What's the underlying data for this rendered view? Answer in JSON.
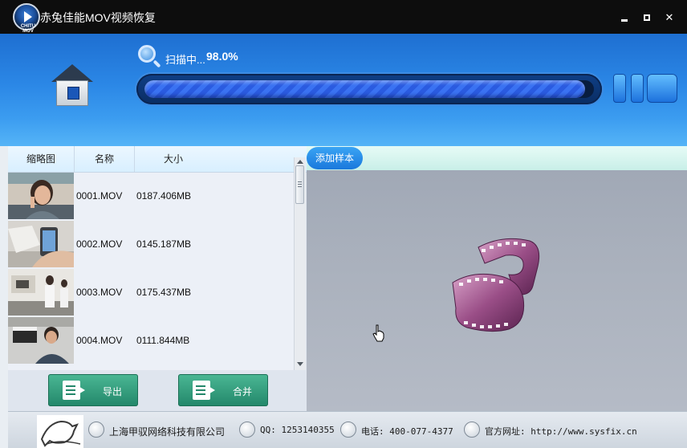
{
  "window": {
    "title": "赤兔佳能MOV视频恢复",
    "logo_text": "CHITU MOV"
  },
  "scan": {
    "label": "扫描中...",
    "percent": "98.0%",
    "progress": 0.98
  },
  "table": {
    "columns": [
      "缩略图",
      "名称",
      "大小"
    ],
    "rows": [
      {
        "name": "0001.MOV",
        "size": "0187.406MB"
      },
      {
        "name": "0002.MOV",
        "size": "0145.187MB"
      },
      {
        "name": "0003.MOV",
        "size": "0175.437MB"
      },
      {
        "name": "0004.MOV",
        "size": "0111.844MB"
      }
    ]
  },
  "buttons": {
    "export": "导出",
    "merge": "合并",
    "add_sample": "添加样本"
  },
  "footer": {
    "company": "上海甲驭网络科技有限公司",
    "qq": "QQ: 1253140355",
    "phone": "电话: 400-077-4377",
    "website": "官方网址: http://www.sysfix.cn"
  },
  "icons": {
    "home": "home-icon",
    "scan": "magnifier-icon",
    "pause": "pause-icon",
    "stop": "stop-icon",
    "film": "film-reel-icon",
    "cursor": "hand-cursor-icon"
  },
  "colors": {
    "header_blue": "#2b87e6",
    "progress_blue": "#2a5be0",
    "action_green": "#23876a",
    "add_sample_blue": "#1a78dc",
    "title_bar": "#0d0d0d"
  }
}
